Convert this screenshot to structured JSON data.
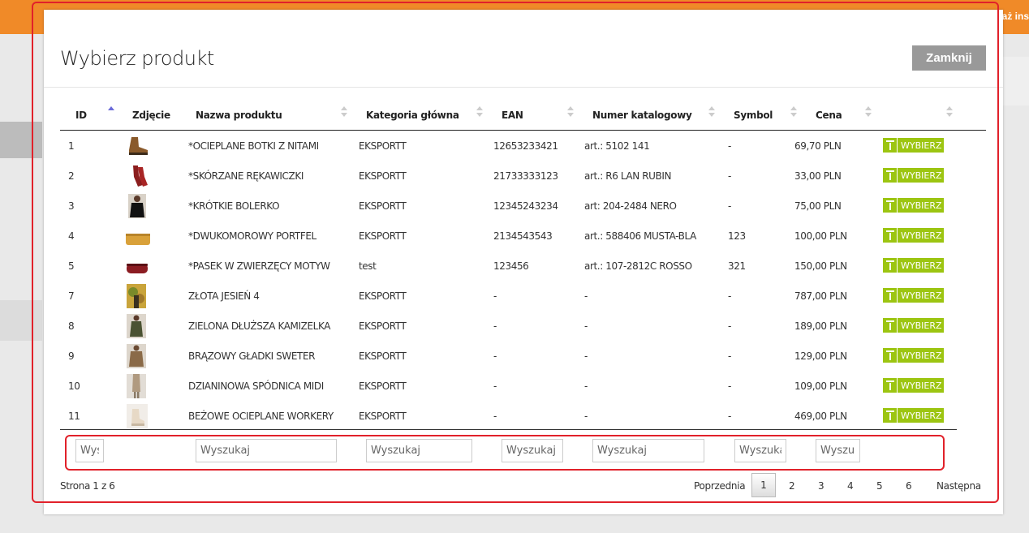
{
  "background": {
    "topbar_text": "każ ins"
  },
  "modal": {
    "title": "Wybierz produkt",
    "close_label": "Zamknij"
  },
  "table": {
    "headers": [
      "ID",
      "Zdjęcie",
      "Nazwa produktu",
      "Kategoria główna",
      "EAN",
      "Numer katalogowy",
      "Symbol",
      "Cena"
    ],
    "select_label": "WYBIERZ",
    "rows": [
      {
        "id": "1",
        "name": "*OCIEPLANE BOTKI Z NITAMI",
        "category": "EKSPORTT",
        "ean": "12653233421",
        "catalog": "art.: 5102 141",
        "symbol": "-",
        "price": "69,70 PLN",
        "thumb": "boots-thumb"
      },
      {
        "id": "2",
        "name": "*SKÓRZANE RĘKAWICZKI",
        "category": "EKSPORTT",
        "ean": "21733333123",
        "catalog": "art.: R6 LAN RUBIN",
        "symbol": "-",
        "price": "33,00 PLN",
        "thumb": "gloves-thumb"
      },
      {
        "id": "3",
        "name": "*KRÓTKIE BOLERKO",
        "category": "EKSPORTT",
        "ean": "12345243234",
        "catalog": "art: 204-2484 NERO",
        "symbol": "-",
        "price": "75,00 PLN",
        "thumb": "bolero-thumb"
      },
      {
        "id": "4",
        "name": "*DWUKOMOROWY PORTFEL",
        "category": "EKSPORTT",
        "ean": "2134543543",
        "catalog": "art.: 588406 MUSTA-BLA",
        "symbol": "123",
        "price": "100,00 PLN",
        "thumb": "wallet-thumb"
      },
      {
        "id": "5",
        "name": "*PASEK W ZWIERZĘCY MOTYW",
        "category": "test",
        "ean": "123456",
        "catalog": "art.: 107-2812C ROSSO",
        "symbol": "321",
        "price": "150,00 PLN",
        "thumb": "belt-thumb"
      },
      {
        "id": "7",
        "name": "ZŁOTA JESIEŃ 4",
        "category": "EKSPORTT",
        "ean": "-",
        "catalog": "-",
        "symbol": "-",
        "price": "787,00 PLN",
        "thumb": "autumn-thumb"
      },
      {
        "id": "8",
        "name": "ZIELONA DŁUŻSZA KAMIZELKA",
        "category": "EKSPORTT",
        "ean": "-",
        "catalog": "-",
        "symbol": "-",
        "price": "189,00 PLN",
        "thumb": "vest-thumb"
      },
      {
        "id": "9",
        "name": "BRĄZOWY GŁADKI SWETER",
        "category": "EKSPORTT",
        "ean": "-",
        "catalog": "-",
        "symbol": "-",
        "price": "129,00 PLN",
        "thumb": "sweater-thumb"
      },
      {
        "id": "10",
        "name": "DZIANINOWA SPÓDNICA MIDI",
        "category": "EKSPORTT",
        "ean": "-",
        "catalog": "-",
        "symbol": "-",
        "price": "109,00 PLN",
        "thumb": "skirt-thumb"
      },
      {
        "id": "11",
        "name": "BEŻOWE OCIEPLANE WORKERY",
        "category": "EKSPORTT",
        "ean": "-",
        "catalog": "-",
        "symbol": "-",
        "price": "469,00 PLN",
        "thumb": "workers-thumb"
      }
    ]
  },
  "search": {
    "placeholder": "Wyszukaj"
  },
  "pagination": {
    "info": "Strona 1 z 6",
    "prev": "Poprzednia",
    "next": "Następna",
    "current": "1",
    "pages": [
      "2",
      "3",
      "4",
      "5",
      "6"
    ]
  }
}
